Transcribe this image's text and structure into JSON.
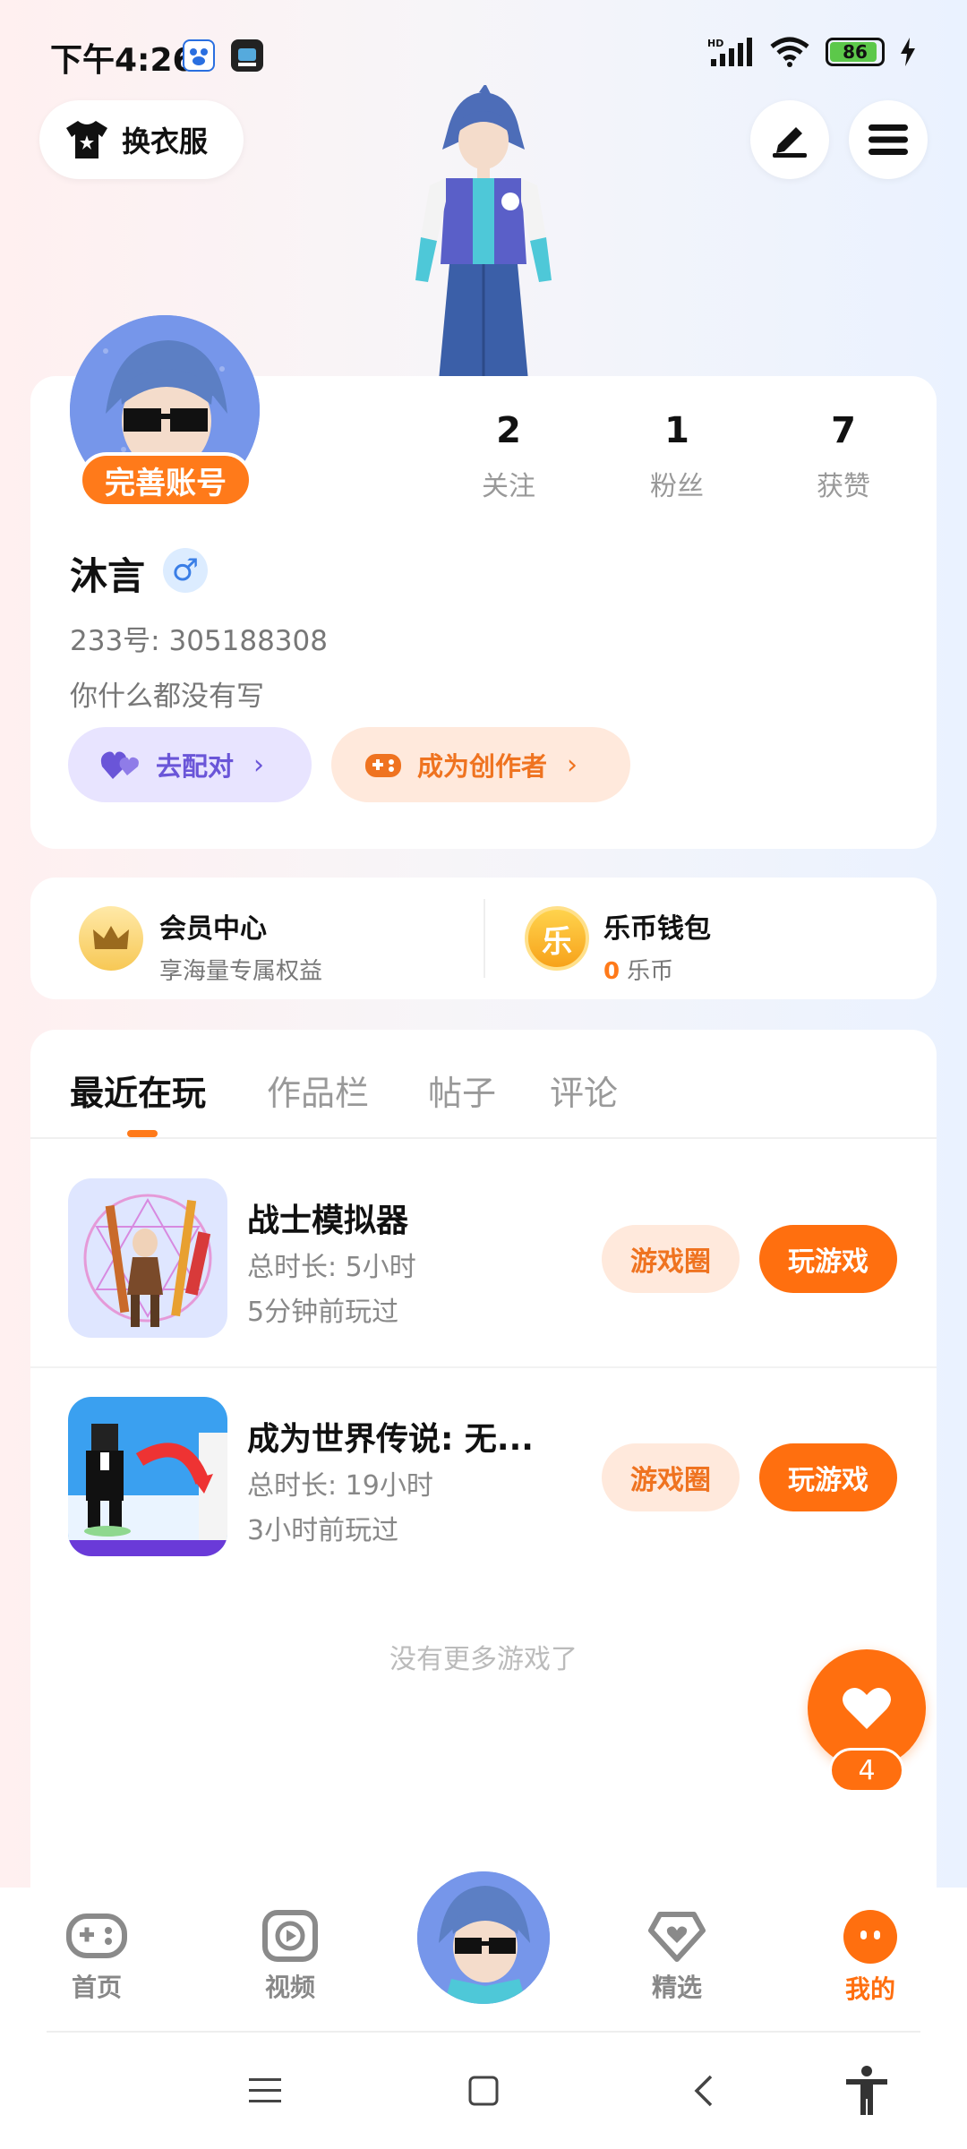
{
  "status_bar": {
    "time": "下午4:26",
    "battery": "86"
  },
  "top": {
    "dress_label": "换衣服"
  },
  "profile": {
    "complete_label": "完善账号",
    "name": "沐言",
    "gender_symbol": "♂",
    "id_line": "233号: 305188308",
    "bio": "你什么都没有写",
    "stats": [
      {
        "value": "2",
        "label": "关注"
      },
      {
        "value": "1",
        "label": "粉丝"
      },
      {
        "value": "7",
        "label": "获赞"
      }
    ],
    "match_label": "去配对",
    "creator_label": "成为创作者",
    "arrow": "›"
  },
  "member": {
    "title": "会员中心",
    "subtitle": "享海量专属权益",
    "wallet_title": "乐币钱包",
    "coin_count": "0",
    "coin_unit": "乐币",
    "coin_glyph": "乐"
  },
  "tabs": [
    "最近在玩",
    "作品栏",
    "帖子",
    "评论"
  ],
  "games": [
    {
      "name": "战士模拟器",
      "duration": "总时长: 5小时",
      "last_played": "5分钟前玩过",
      "circle_label": "游戏圈",
      "play_label": "玩游戏"
    },
    {
      "name": "成为世界传说: 无...",
      "duration": "总时长: 19小时",
      "last_played": "3小时前玩过",
      "circle_label": "游戏圈",
      "play_label": "玩游戏"
    }
  ],
  "no_more": "没有更多游戏了",
  "heart_count": "4",
  "nav": {
    "home": "首页",
    "video": "视频",
    "featured": "精选",
    "mine": "我的"
  },
  "colors": {
    "accent": "#ff6f0f",
    "purple": "#6a55d8"
  }
}
